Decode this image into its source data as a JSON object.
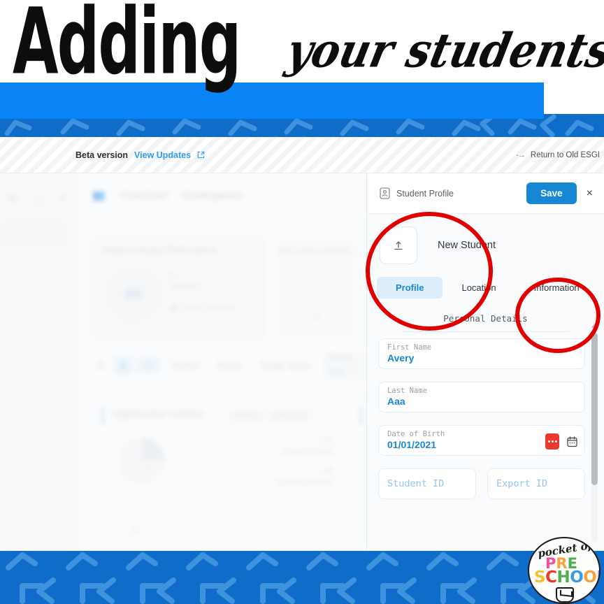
{
  "header": {
    "title_main": "Adding",
    "title_script": "your students"
  },
  "beta_bar": {
    "beta_label": "Beta version",
    "view_updates": "View Updates",
    "external_link_icon": "external-link-icon",
    "return_arrow_icon": "arrow-right-icon",
    "return_label": "Return to Old ESGI"
  },
  "background": {
    "rail_icons": [
      "pencil-icon",
      "more-vertical-icon",
      "plus-icon"
    ],
    "class_tabs": [
      "Preschool",
      "Kindergarten"
    ],
    "widget": {
      "title": "Yearly Average Performance",
      "percent": "0%",
      "sessions_count": "0",
      "sessions_label": "Sessions",
      "since_label": "Since Last Week"
    },
    "add_widgets": "Add more widgets",
    "filters": {
      "view_list_icon": "list-view-icon",
      "view_grid_icon": "grid-view-icon",
      "pills": [
        "All",
        "Yes/No",
        "Rubric",
        "Single Score"
      ],
      "selected_pill": "All",
      "tested_label": "Tested",
      "tested_value": "Any"
    },
    "card": {
      "title": "Uppercase Letters",
      "chip_type": "Yes/No",
      "chip_standard": "K.RF.1.A.a",
      "student_tested_value": "—/0",
      "student_tested_label": "Student Tested",
      "correct_value": "—/0",
      "correct_label": "Correct answers",
      "dash": "—"
    }
  },
  "panel": {
    "icon": "id-card-icon",
    "title": "Student Profile",
    "save_label": "Save",
    "close_label": "×",
    "avatar": {
      "upload_icon": "upload-icon",
      "name": "New Student"
    },
    "tabs": [
      {
        "label": "Profile",
        "active": true
      },
      {
        "label": "Location",
        "active": false
      },
      {
        "label": "Information",
        "active": false
      }
    ],
    "section_title": "Personal Details",
    "fields": {
      "first_name_label": "First Name",
      "first_name_value": "Avery",
      "last_name_label": "Last Name",
      "last_name_value": "Aaa",
      "dob_label": "Date of Birth",
      "dob_value": "01/01/2021",
      "dob_dots_icon": "red-dots-icon",
      "dob_calendar_icon": "calendar-icon",
      "student_id_placeholder": "Student ID",
      "export_id_placeholder": "Export ID"
    }
  },
  "logo": {
    "pocket": "pocket of",
    "pre": "PRE",
    "school": "SCHOOL"
  },
  "colors": {
    "brand_blue": "#1787d4",
    "band_light": "#0a84f5",
    "band_dark": "#0f6cc9",
    "chevron": "#3f92dd",
    "annotation_red": "#e00000",
    "link_blue": "#2e9bf0",
    "tab_active_bg": "#dceefb"
  }
}
